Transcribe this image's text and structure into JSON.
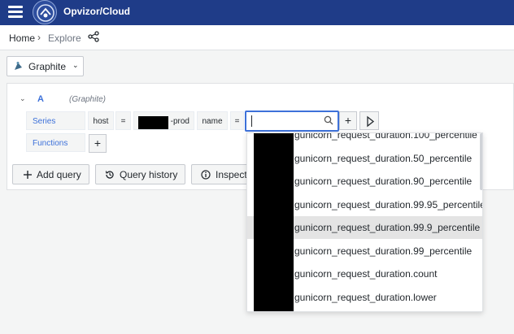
{
  "topbar": {
    "title": "Opvizor/Cloud"
  },
  "breadcrumb": {
    "home": "Home",
    "separator": "›",
    "current": "Explore"
  },
  "datasource": {
    "label": "Graphite"
  },
  "query": {
    "letter": "A",
    "datasource_hint": "(Graphite)",
    "series_label": "Series",
    "functions_label": "Functions",
    "tag1_key": "host",
    "tag1_op": "=",
    "tag1_value_suffix": "-prod",
    "tag2_key": "name",
    "tag2_op": "=",
    "add_tag": "+",
    "add_function": "+"
  },
  "buttons": {
    "add_query": "Add query",
    "query_history": "Query history",
    "inspector": "Inspector"
  },
  "dropdown": {
    "options": [
      "gunicorn_request_duration.100_percentile",
      "gunicorn_request_duration.50_percentile",
      "gunicorn_request_duration.90_percentile",
      "gunicorn_request_duration.99.95_percentile",
      "gunicorn_request_duration.99.9_percentile",
      "gunicorn_request_duration.99_percentile",
      "gunicorn_request_duration.count",
      "gunicorn_request_duration.lower"
    ],
    "highlighted_index": 4
  },
  "colors": {
    "topbar": "#1f3c88",
    "accent": "#3d71d9",
    "highlight": "#e4e4e4"
  }
}
